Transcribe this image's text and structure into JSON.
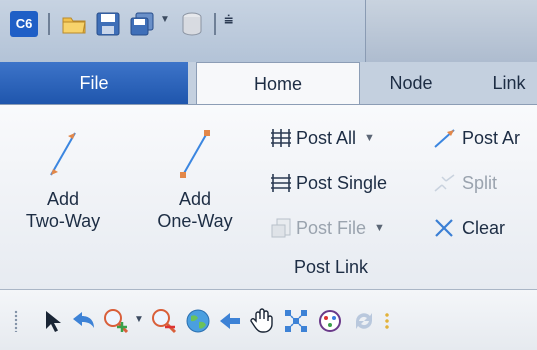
{
  "app_badge": "C6",
  "tabs": [
    "File",
    "Home",
    "Node",
    "Link"
  ],
  "ribbon": {
    "add_two_way": [
      "Add",
      "Two-Way"
    ],
    "add_one_way": [
      "Add",
      "One-Way"
    ],
    "post_all": "Post All",
    "post_single": "Post Single",
    "post_file": "Post File",
    "post_arrow": "Post Ar",
    "split": "Split",
    "clear": "Clear",
    "group_label": "Post Link"
  },
  "colors": {
    "file_tab": "#2a63bd",
    "accent_blue": "#3b86e0",
    "accent_orange": "#e2884a",
    "clear_x": "#3b7fd4"
  },
  "toolbar_icons": [
    "pointer-icon",
    "undo-icon",
    "zoom-in-icon",
    "zoom-dropdown-icon",
    "zoom-out-icon",
    "globe-icon",
    "back-arrow-icon",
    "pan-hand-icon",
    "fit-nodes-icon",
    "node-select-icon",
    "refresh-icon",
    "more-icon"
  ]
}
